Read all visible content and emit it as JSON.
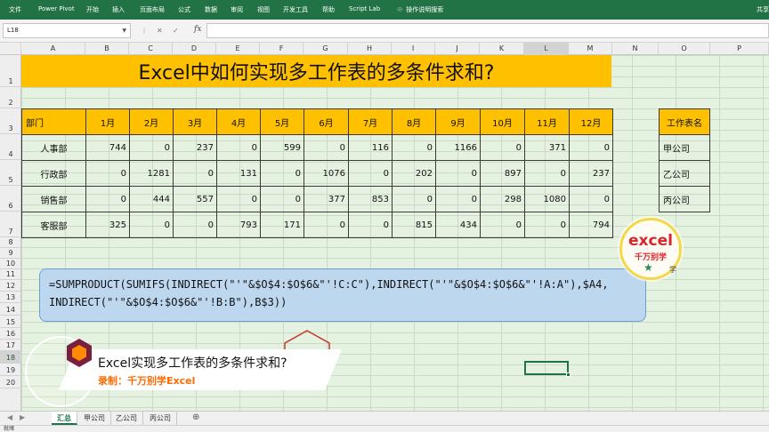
{
  "ribbon": {
    "tabs": [
      "文件",
      "Power Pivot",
      "开始",
      "插入",
      "页面布局",
      "公式",
      "数据",
      "审阅",
      "视图",
      "开发工具",
      "帮助",
      "Script Lab"
    ],
    "tell_me": "操作说明搜索",
    "share": "共享"
  },
  "formula_bar": {
    "name_box": "L18",
    "fx": "fx",
    "formula": ""
  },
  "columns": [
    "A",
    "B",
    "C",
    "D",
    "E",
    "F",
    "G",
    "H",
    "I",
    "J",
    "K",
    "L",
    "M",
    "N",
    "O",
    "P"
  ],
  "selected_column": "L",
  "rows": [
    "1",
    "2",
    "3",
    "4",
    "5",
    "6",
    "7",
    "8",
    "9",
    "10",
    "11",
    "12",
    "13",
    "14",
    "15",
    "16",
    "17",
    "18",
    "19",
    "20"
  ],
  "selected_row": "18",
  "title": "Excel中如何实现多工作表的多条件求和?",
  "table": {
    "header": [
      "部门",
      "1月",
      "2月",
      "3月",
      "4月",
      "5月",
      "6月",
      "7月",
      "8月",
      "9月",
      "10月",
      "11月",
      "12月"
    ],
    "rows": [
      [
        "人事部",
        "744",
        "0",
        "237",
        "0",
        "599",
        "0",
        "116",
        "0",
        "1166",
        "0",
        "371",
        "0"
      ],
      [
        "行政部",
        "0",
        "1281",
        "0",
        "131",
        "0",
        "1076",
        "0",
        "202",
        "0",
        "897",
        "0",
        "237"
      ],
      [
        "销售部",
        "0",
        "444",
        "557",
        "0",
        "0",
        "377",
        "853",
        "0",
        "0",
        "298",
        "1080",
        "0"
      ],
      [
        "客服部",
        "325",
        "0",
        "0",
        "793",
        "171",
        "0",
        "0",
        "815",
        "434",
        "0",
        "0",
        "794"
      ]
    ]
  },
  "sheet_names_table": {
    "header": "工作表名",
    "items": [
      "甲公司",
      "乙公司",
      "丙公司"
    ]
  },
  "formula_display": {
    "line1": "=SUMPRODUCT(SUMIFS(INDIRECT(\"'\"&$O$4:$O$6&\"'!C:C\"),INDIRECT(\"'\"&$O$4:$O$6&\"'!A:A\"),$A4,",
    "line2": "INDIRECT(\"'\"&$O$4:$O$6&\"'!B:B\"),B$3))"
  },
  "overlay": {
    "title": "Excel实现多工作表的多条件求和?",
    "subtitle": "录制：千万别学Excel"
  },
  "logo": {
    "word": "excel",
    "sub": "千万别学",
    "mark": "学"
  },
  "sheets": [
    "汇总",
    "甲公司",
    "乙公司",
    "丙公司"
  ],
  "active_sheet": "汇总",
  "status": "就绪",
  "colors": {
    "excel_green": "#217346",
    "header_gold": "#ffc000",
    "formula_bg": "#bdd7ee",
    "grid_bg": "#e5f2e1",
    "accent_orange": "#ff6a00"
  }
}
